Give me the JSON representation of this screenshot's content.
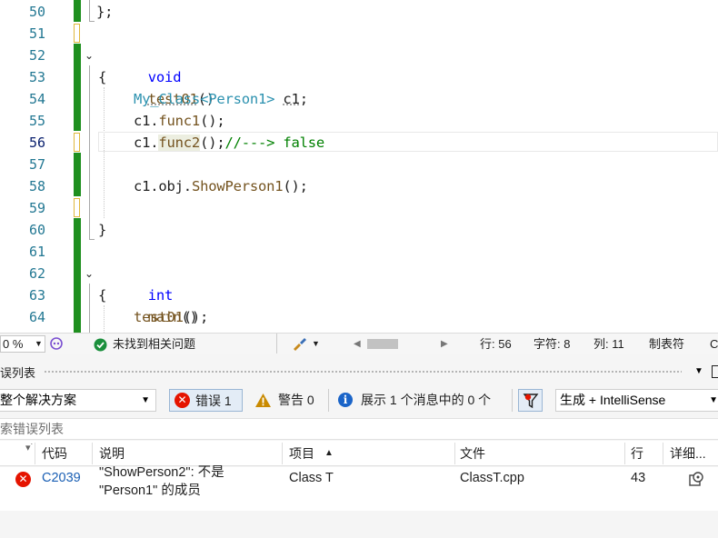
{
  "editor": {
    "line_numbers": [
      "50",
      "51",
      "52",
      "53",
      "54",
      "55",
      "56",
      "57",
      "58",
      "59",
      "60",
      "61",
      "62",
      "63",
      "64"
    ],
    "current_line": "56",
    "lines": {
      "l50": "};",
      "l52_kw": "void",
      "l52_fn": "test01",
      "l52_rest": "()",
      "l53": "{",
      "l54_type": "My_Class",
      "l54_lt": "<",
      "l54_arg": "Person1",
      "l54_gt": ">",
      "l54_var": "c1",
      "l54_end": ";",
      "l55_obj": "c1.",
      "l55_fn": "func1",
      "l55_end": "();",
      "l56_obj": "c1.",
      "l56_fn": "func2",
      "l56_end": "();",
      "l56_comment": "//---> false",
      "l58_obj": "c1.obj.",
      "l58_fn": "ShowPerson1",
      "l58_end": "();",
      "l60": "}",
      "l62_kw": "int",
      "l62_fn": "main",
      "l62_rest": "()",
      "l63": "{",
      "l64_fn": "test01",
      "l64_end": "();"
    }
  },
  "statusbar": {
    "zoom": "0 %",
    "issues": "未找到相关问题",
    "line": "行: 56",
    "char": "字符: 8",
    "col": "列: 11",
    "tabs": "制表符",
    "crlf": "C"
  },
  "errorlist": {
    "title": "误列表",
    "scope": "整个解决方案",
    "errors_btn": "错误 1",
    "warnings_btn": "警告 0",
    "messages_btn": "展示 1 个消息中的 0 个",
    "build_filter": "生成 + IntelliSense",
    "search_placeholder": "索错误列表",
    "columns": {
      "code": "代码",
      "desc": "说明",
      "project": "项目",
      "file": "文件",
      "line": "行",
      "details": "详细..."
    },
    "rows": [
      {
        "code": "C2039",
        "desc_line1": "\"ShowPerson2\": 不是",
        "desc_line2": "\"Person1\" 的成员",
        "project": "Class T",
        "file": "ClassT.cpp",
        "line": "43"
      }
    ]
  },
  "colors": {
    "keyword": "#0000ff",
    "type": "#2b91af",
    "function": "#74531f",
    "comment": "#008000",
    "gutter_saved": "#1e8f1e",
    "error": "#e51400"
  }
}
